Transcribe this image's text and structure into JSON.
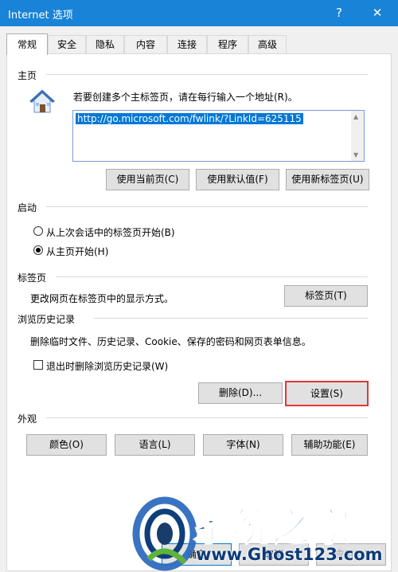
{
  "window": {
    "title": "Internet 选项",
    "help": "?",
    "close": "✕"
  },
  "tabs": [
    "常规",
    "安全",
    "隐私",
    "内容",
    "连接",
    "程序",
    "高级"
  ],
  "homepage": {
    "heading": "主页",
    "instruction": "若要创建多个主标签页，请在每行输入一个地址(R)。",
    "url": "http://go.microsoft.com/fwlink/?LinkId=625115",
    "buttons": [
      "使用当前页(C)",
      "使用默认值(F)",
      "使用新标签页(U)"
    ]
  },
  "startup": {
    "heading": "启动",
    "option_last_session": "从上次会话中的标签页开始(B)",
    "option_homepage": "从主页开始(H)",
    "selected": "option_homepage"
  },
  "tabs_section": {
    "heading": "标签页",
    "description": "更改网页在标签页中的显示方式。",
    "button": "标签页(T)"
  },
  "history": {
    "heading": "浏览历史记录",
    "description": "删除临时文件、历史记录、Cookie、保存的密码和网页表单信息。",
    "checkbox": "退出时删除浏览历史记录(W)",
    "checked": false,
    "delete_button": "删除(D)...",
    "settings_button": "设置(S)"
  },
  "appearance": {
    "heading": "外观",
    "buttons": [
      "颜色(O)",
      "语言(L)",
      "字体(N)",
      "辅助功能(E)"
    ]
  },
  "footer": {
    "ok": "确定",
    "cancel": "取消",
    "apply": "应用(A)"
  },
  "watermark": {
    "title": "系统之家",
    "url": "www.Ghost123.com"
  },
  "colors": {
    "titlebar": "#1883d7",
    "highlight": "#e0373c",
    "selection": "#0078d7"
  }
}
